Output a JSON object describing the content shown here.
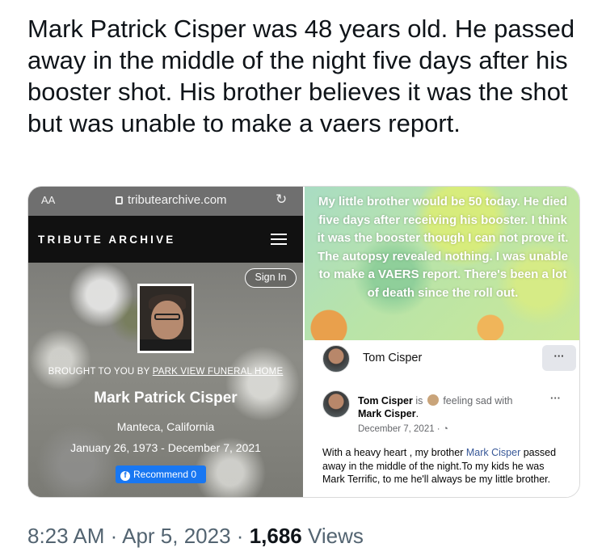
{
  "tweet": {
    "text": "Mark Patrick Cisper was 48 years old. He passed away in the middle of the night five days after his booster shot. His brother believes it was the shot but was unable to make a vaers report.",
    "time": "8:23 AM",
    "sep1": "·",
    "date": "Apr 5, 2023",
    "sep2": "·",
    "views_count": "1,686",
    "views_label": "Views"
  },
  "left_panel": {
    "browser": {
      "aa": "AA",
      "url": "tributearchive.com",
      "reload_icon": "↻"
    },
    "site_brand": "TRIBUTE ARCHIVE",
    "sign_in": "Sign In",
    "brought_prefix": "BROUGHT TO YOU BY",
    "brought_link": "PARK VIEW FUNERAL HOME",
    "name": "Mark Patrick Cisper",
    "place": "Manteca, California",
    "dates": "January 26, 1973 - December 7, 2021",
    "recommend_label": "Recommend",
    "recommend_count": "0"
  },
  "right_panel": {
    "image_text": "My little brother would be 50 today. He died five days after receiving his booster. I think it was the booster though I can not prove it. The autopsy revealed nothing. I was unable to make a VAERS report. There's been a lot of death since the roll out.",
    "poster_name": "Tom Cisper",
    "more_dots": "···",
    "post": {
      "author": "Tom Cisper",
      "is": "is",
      "feeling": "feeling sad with",
      "tagged": "Mark Cisper",
      "period": ".",
      "date": "December 7, 2021 ·",
      "more": "···",
      "body_prefix": "With a heavy heart , my brother",
      "body_mention": "Mark Cisper",
      "body_rest": "passed away in the middle of the night.To my kids he was Mark Terrific, to me he'll always be my little brother."
    }
  },
  "colors": {
    "facebook_blue": "#1877f2",
    "meta_gray": "#536471"
  }
}
